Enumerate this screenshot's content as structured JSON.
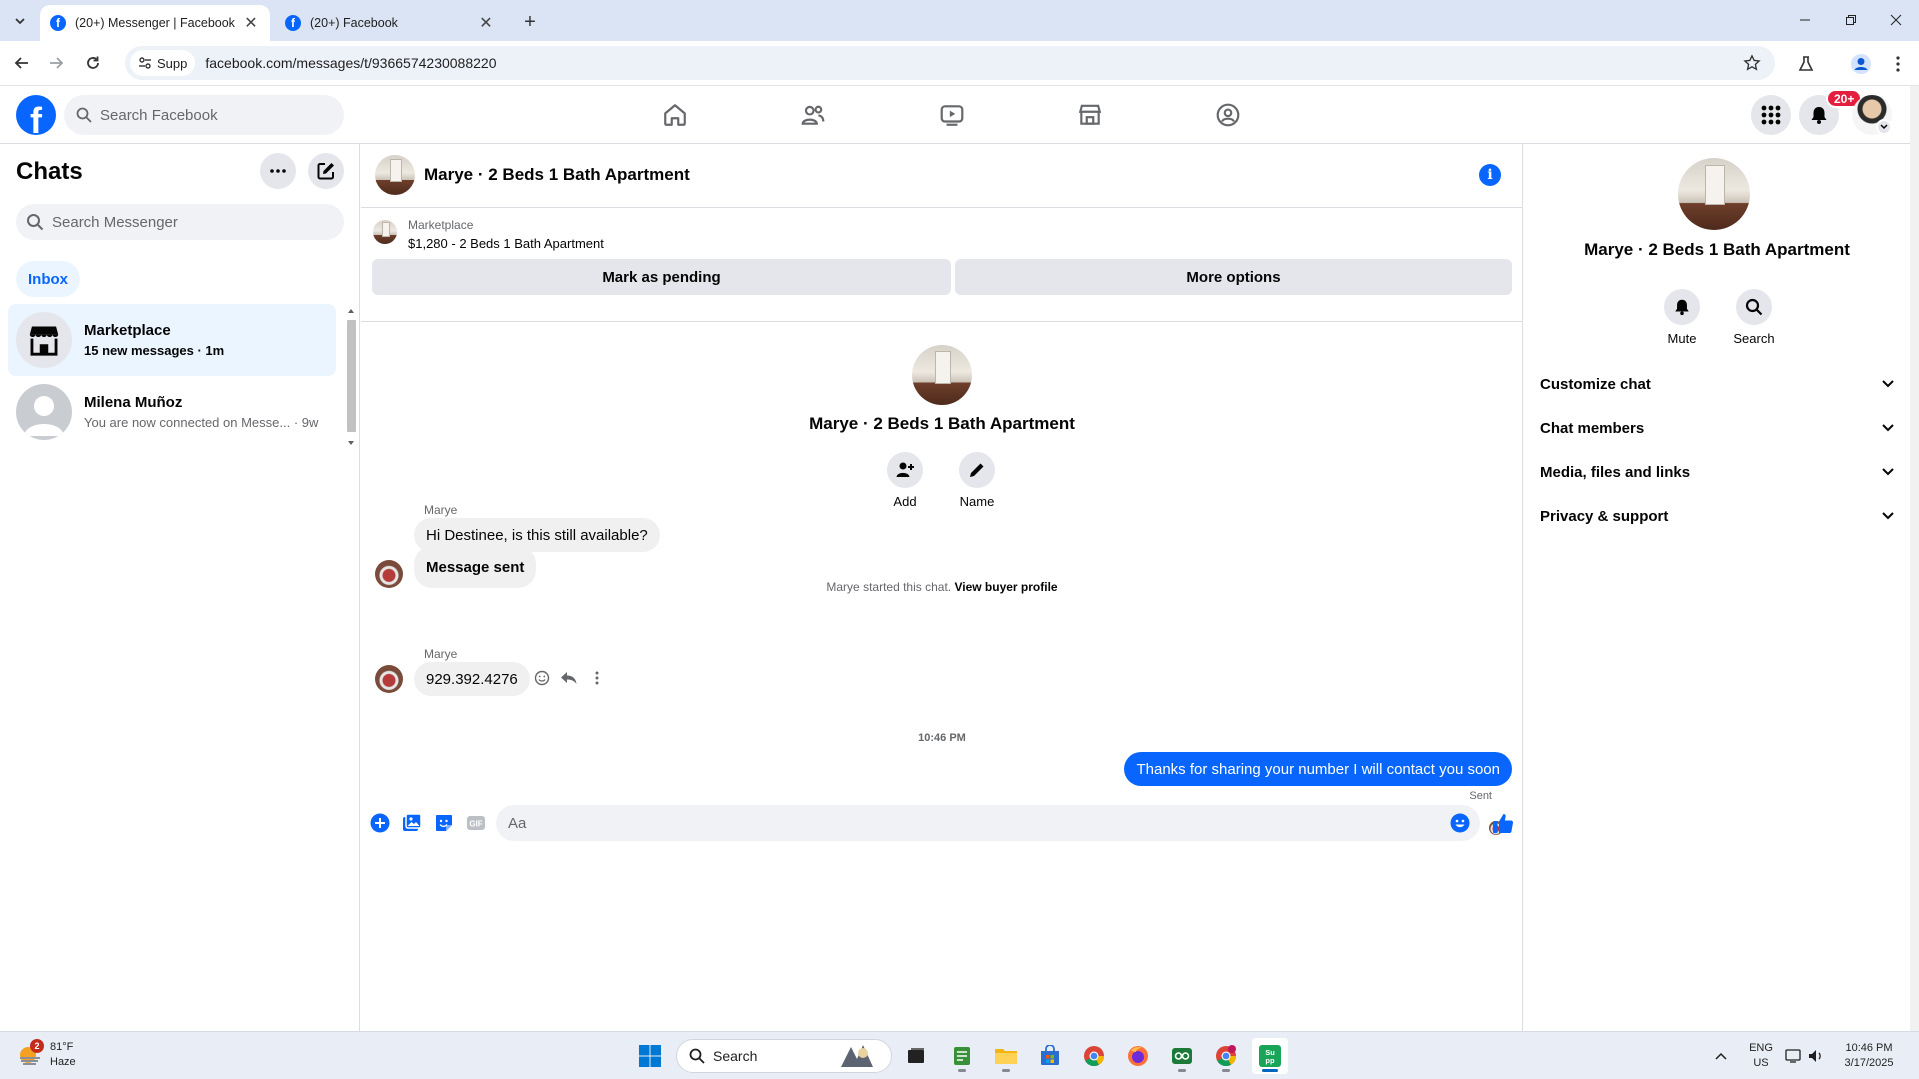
{
  "browser": {
    "tabs": [
      {
        "title": "(20+) Messenger | Facebook",
        "active": true
      },
      {
        "title": "(20+) Facebook",
        "active": false
      }
    ],
    "site_chip": "Supp",
    "url": "facebook.com/messages/t/9366574230088220"
  },
  "fb": {
    "search_placeholder": "Search Facebook",
    "notification_badge": "20+",
    "nav": [
      "home-icon",
      "friends-icon",
      "video-icon",
      "marketplace-icon",
      "groups-icon"
    ]
  },
  "chats": {
    "title": "Chats",
    "search_placeholder": "Search Messenger",
    "filter": "Inbox",
    "items": [
      {
        "name": "Marketplace",
        "sub": "15 new messages · 1m",
        "selected": true
      },
      {
        "name": "Milena Muñoz",
        "sub": "You are now connected on Messe... · 9w",
        "selected": false
      }
    ]
  },
  "conversation": {
    "title": "Marye · 2 Beds 1 Bath Apartment",
    "marketplace_label": "Marketplace",
    "listing": "$1,280 - 2 Beds 1 Bath Apartment",
    "buttons": {
      "pending": "Mark as pending",
      "more": "More options"
    },
    "intro_name": "Marye · 2 Beds 1 Bath Apartment",
    "intro_actions": {
      "add": "Add",
      "name": "Name"
    },
    "system_message": "Marye started this chat.",
    "system_link": "View buyer profile",
    "messages": [
      {
        "sender": "Marye",
        "text": "Hi Destinee, is this still available?"
      },
      {
        "text": "Message sent"
      },
      {
        "sender": "Marye",
        "text": "929.392.4276"
      }
    ],
    "time_separator": "10:46 PM",
    "outgoing": "Thanks for sharing your number I will contact you soon",
    "sent_status": "Sent",
    "composer_placeholder": "Aa"
  },
  "info_pane": {
    "name": "Marye · 2 Beds 1 Bath Apartment",
    "actions": {
      "mute": "Mute",
      "search": "Search"
    },
    "sections": [
      "Customize chat",
      "Chat members",
      "Media, files and links",
      "Privacy & support"
    ]
  },
  "taskbar": {
    "weather_temp": "81°F",
    "weather_desc": "Haze",
    "weather_badge": "2",
    "search_label": "Search",
    "lang_top": "ENG",
    "lang_bottom": "US",
    "time": "10:46 PM",
    "date": "3/17/2025"
  },
  "colors": {
    "accent": "#0866ff",
    "badge": "#e41e3f"
  }
}
